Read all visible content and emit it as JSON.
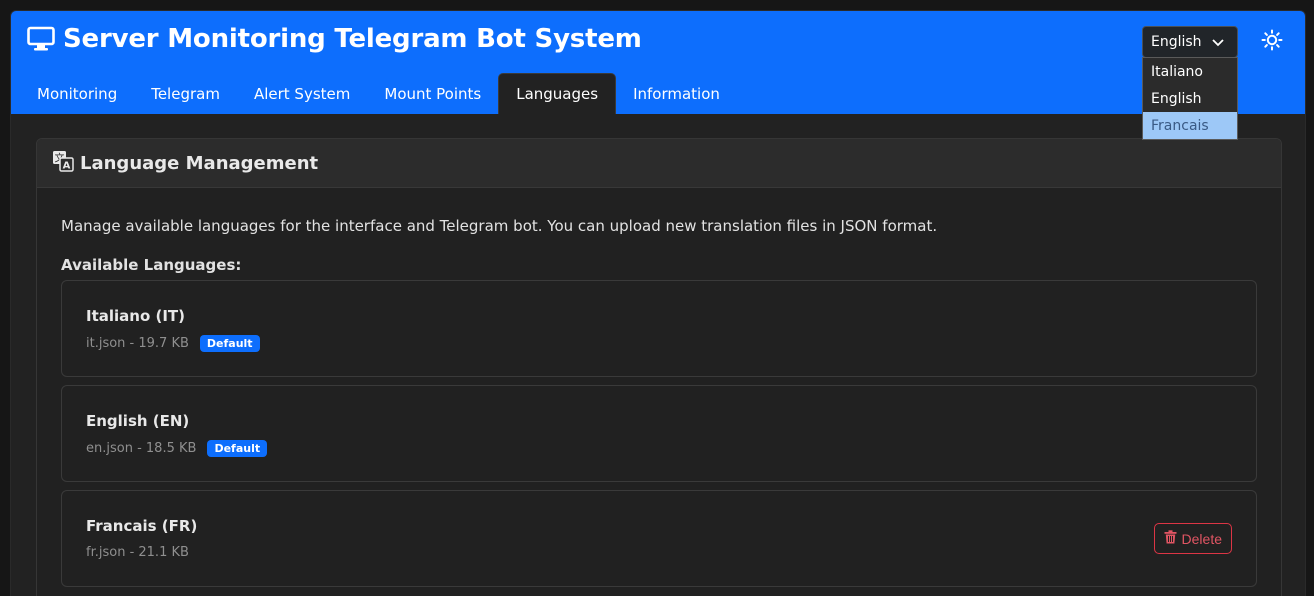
{
  "app": {
    "title": "Server Monitoring Telegram Bot System",
    "title_icon": "monitor-icon"
  },
  "tabs": [
    {
      "label": "Monitoring",
      "active": false
    },
    {
      "label": "Telegram",
      "active": false
    },
    {
      "label": "Alert System",
      "active": false
    },
    {
      "label": "Mount Points",
      "active": false
    },
    {
      "label": "Languages",
      "active": true
    },
    {
      "label": "Information",
      "active": false
    }
  ],
  "language_select": {
    "selected": "English",
    "options": [
      "Italiano",
      "English",
      "Francais"
    ],
    "highlighted": "Francais"
  },
  "theme_toggle": {
    "icon": "sun-icon"
  },
  "card": {
    "title": "Language Management",
    "title_icon": "translate-icon",
    "intro": "Manage available languages for the interface and Telegram bot. You can upload new translation files in JSON format.",
    "available_label": "Available Languages:",
    "languages": [
      {
        "name": "Italiano (IT)",
        "file": "it.json - 19.7 KB",
        "badge": "Default",
        "delete": null
      },
      {
        "name": "English (EN)",
        "file": "en.json - 18.5 KB",
        "badge": "Default",
        "delete": null
      },
      {
        "name": "Francais (FR)",
        "file": "fr.json - 21.1 KB",
        "badge": null,
        "delete": "Delete"
      }
    ]
  },
  "colors": {
    "primary": "#0d6efd",
    "danger": "#dc3545",
    "background": "#222222"
  }
}
